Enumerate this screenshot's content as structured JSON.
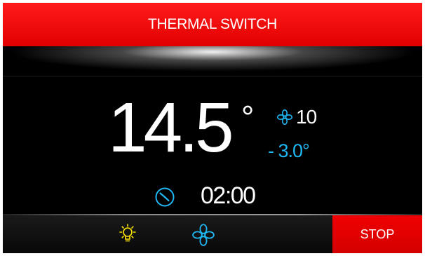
{
  "header": {
    "title": "THERMAL SWITCH"
  },
  "reading": {
    "temperature": "14.5",
    "degree_symbol": "°",
    "fan_speed": "10",
    "setpoint": "- 3.0°"
  },
  "timer": {
    "time": "02:00"
  },
  "controls": {
    "light_icon": "lightbulb-icon",
    "fan_icon": "fan-icon",
    "stop_label": "STOP"
  },
  "colors": {
    "header_red": "#ff0000",
    "accent_blue": "#1fb6f2",
    "light_yellow": "#ffe600",
    "stop_red": "#e60000"
  }
}
